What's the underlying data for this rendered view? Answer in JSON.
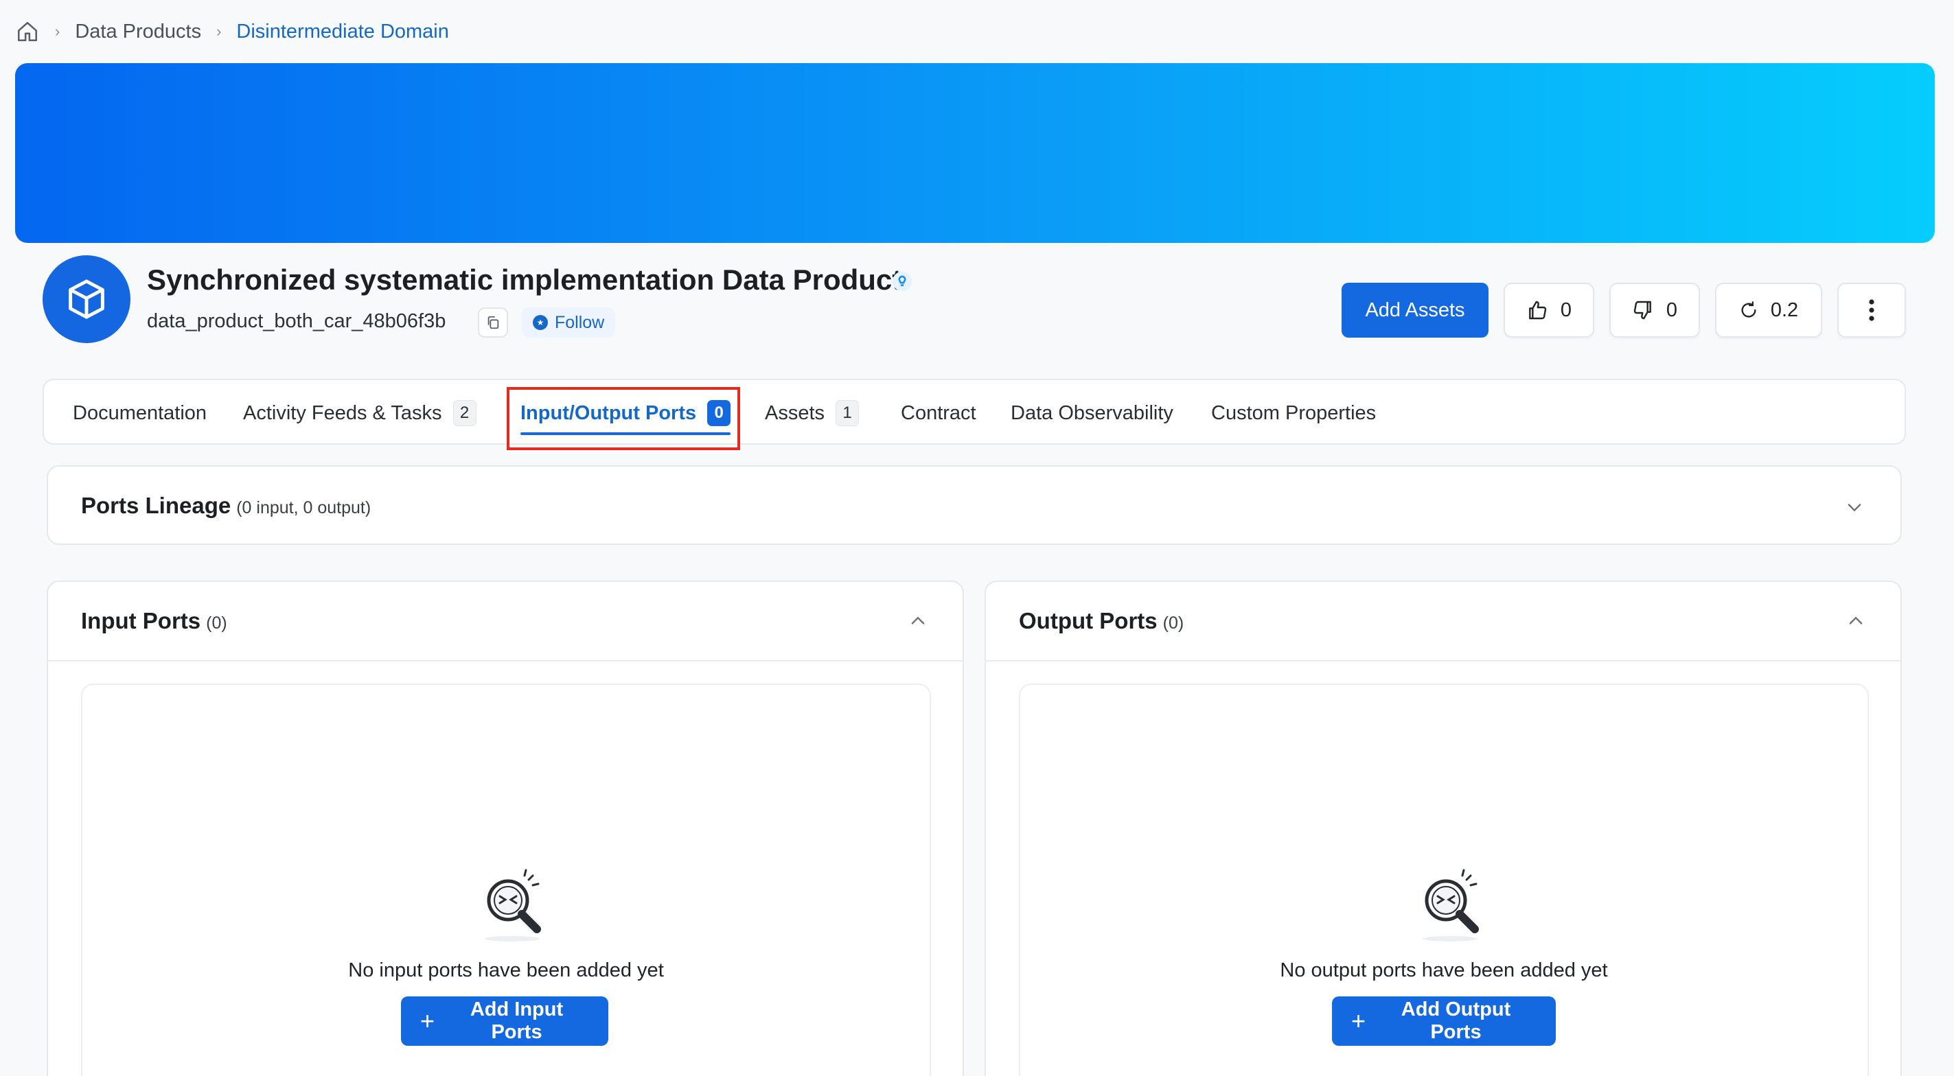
{
  "breadcrumb": {
    "home_icon": "home-icon",
    "items": [
      "Data Products",
      "Disintermediate Domain"
    ]
  },
  "header": {
    "title": "Synchronized systematic implementation Data Product",
    "fqn": "data_product_both_car_48b06f3b",
    "follow_label": "Follow",
    "add_assets_label": "Add Assets",
    "likes": "0",
    "dislikes": "0",
    "version": "0.2"
  },
  "tabs": [
    {
      "label": "Documentation",
      "badge": ""
    },
    {
      "label": "Activity Feeds & Tasks",
      "badge": "2"
    },
    {
      "label": "Input/Output Ports",
      "badge": "0"
    },
    {
      "label": "Assets",
      "badge": "1"
    },
    {
      "label": "Contract",
      "badge": ""
    },
    {
      "label": "Data Observability",
      "badge": ""
    },
    {
      "label": "Custom Properties",
      "badge": ""
    }
  ],
  "lineage": {
    "title": "Ports Lineage",
    "count": "(0 input, 0 output)"
  },
  "input_ports": {
    "title": "Input Ports",
    "count": "(0)",
    "empty_text": "No input ports have been added yet",
    "add_label": "Add Input Ports"
  },
  "output_ports": {
    "title": "Output Ports",
    "count": "(0)",
    "empty_text": "No output ports have been added yet",
    "add_label": "Add Output Ports"
  },
  "colors": {
    "primary": "#1468e0",
    "link": "#1468c8",
    "highlight": "#e32b1f",
    "banner_start": "#0467f0",
    "banner_end": "#05cdfc"
  }
}
